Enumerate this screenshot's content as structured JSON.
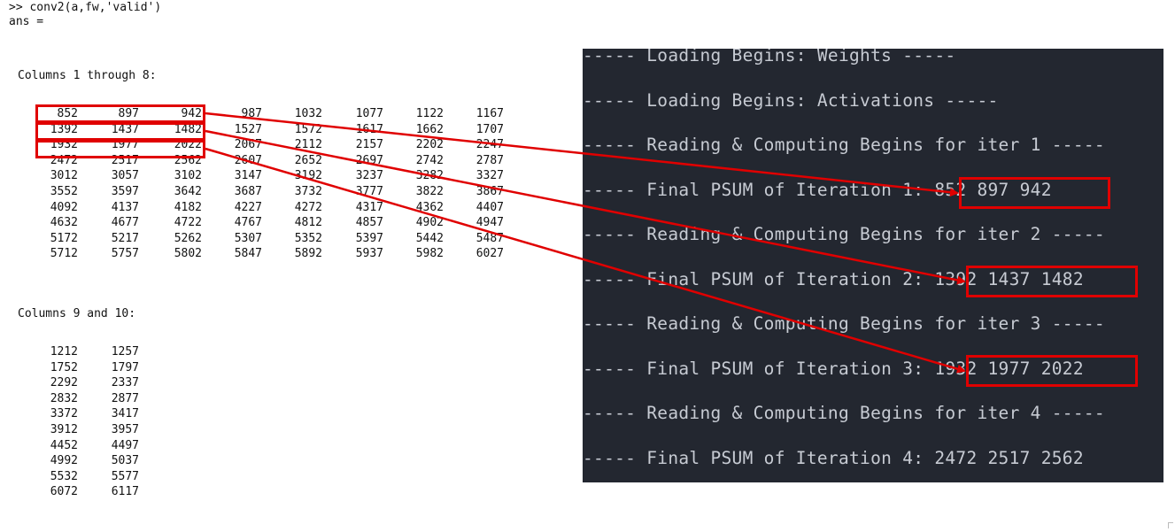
{
  "console": {
    "command": ">> conv2(a,fw,'valid')",
    "ans_label": "ans =",
    "section1_header": "Columns 1 through 8:",
    "section1_rows": [
      [
        "852",
        "897",
        "942",
        "987",
        "1032",
        "1077",
        "1122",
        "1167"
      ],
      [
        "1392",
        "1437",
        "1482",
        "1527",
        "1572",
        "1617",
        "1662",
        "1707"
      ],
      [
        "1932",
        "1977",
        "2022",
        "2067",
        "2112",
        "2157",
        "2202",
        "2247"
      ],
      [
        "2472",
        "2517",
        "2562",
        "2607",
        "2652",
        "2697",
        "2742",
        "2787"
      ],
      [
        "3012",
        "3057",
        "3102",
        "3147",
        "3192",
        "3237",
        "3282",
        "3327"
      ],
      [
        "3552",
        "3597",
        "3642",
        "3687",
        "3732",
        "3777",
        "3822",
        "3867"
      ],
      [
        "4092",
        "4137",
        "4182",
        "4227",
        "4272",
        "4317",
        "4362",
        "4407"
      ],
      [
        "4632",
        "4677",
        "4722",
        "4767",
        "4812",
        "4857",
        "4902",
        "4947"
      ],
      [
        "5172",
        "5217",
        "5262",
        "5307",
        "5352",
        "5397",
        "5442",
        "5487"
      ],
      [
        "5712",
        "5757",
        "5802",
        "5847",
        "5892",
        "5937",
        "5982",
        "6027"
      ]
    ],
    "section2_header": "Columns 9 and 10:",
    "section2_rows": [
      [
        "1212",
        "1257"
      ],
      [
        "1752",
        "1797"
      ],
      [
        "2292",
        "2337"
      ],
      [
        "2832",
        "2877"
      ],
      [
        "3372",
        "3417"
      ],
      [
        "3912",
        "3957"
      ],
      [
        "4452",
        "4497"
      ],
      [
        "4992",
        "5037"
      ],
      [
        "5532",
        "5577"
      ],
      [
        "6072",
        "6117"
      ]
    ]
  },
  "terminal": {
    "lines": [
      "----- Loading Begins: Weights -----",
      "----- Loading Begins: Activations -----",
      "----- Reading & Computing Begins for iter 1 -----",
      "----- Final PSUM of Iteration 1: 852 897 942",
      "----- Reading & Computing Begins for iter 2 -----",
      "----- Final PSUM of Iteration 2: 1392 1437 1482",
      "----- Reading & Computing Begins for iter 3 -----",
      "----- Final PSUM of Iteration 3: 1932 1977 2022",
      "----- Reading & Computing Begins for iter 4 -----",
      "----- Final PSUM of Iteration 4: 2472 2517 2562"
    ]
  },
  "colors": {
    "annotation": "#e00000",
    "terminal_bg": "#232730",
    "terminal_text": "#c7cbd3"
  }
}
